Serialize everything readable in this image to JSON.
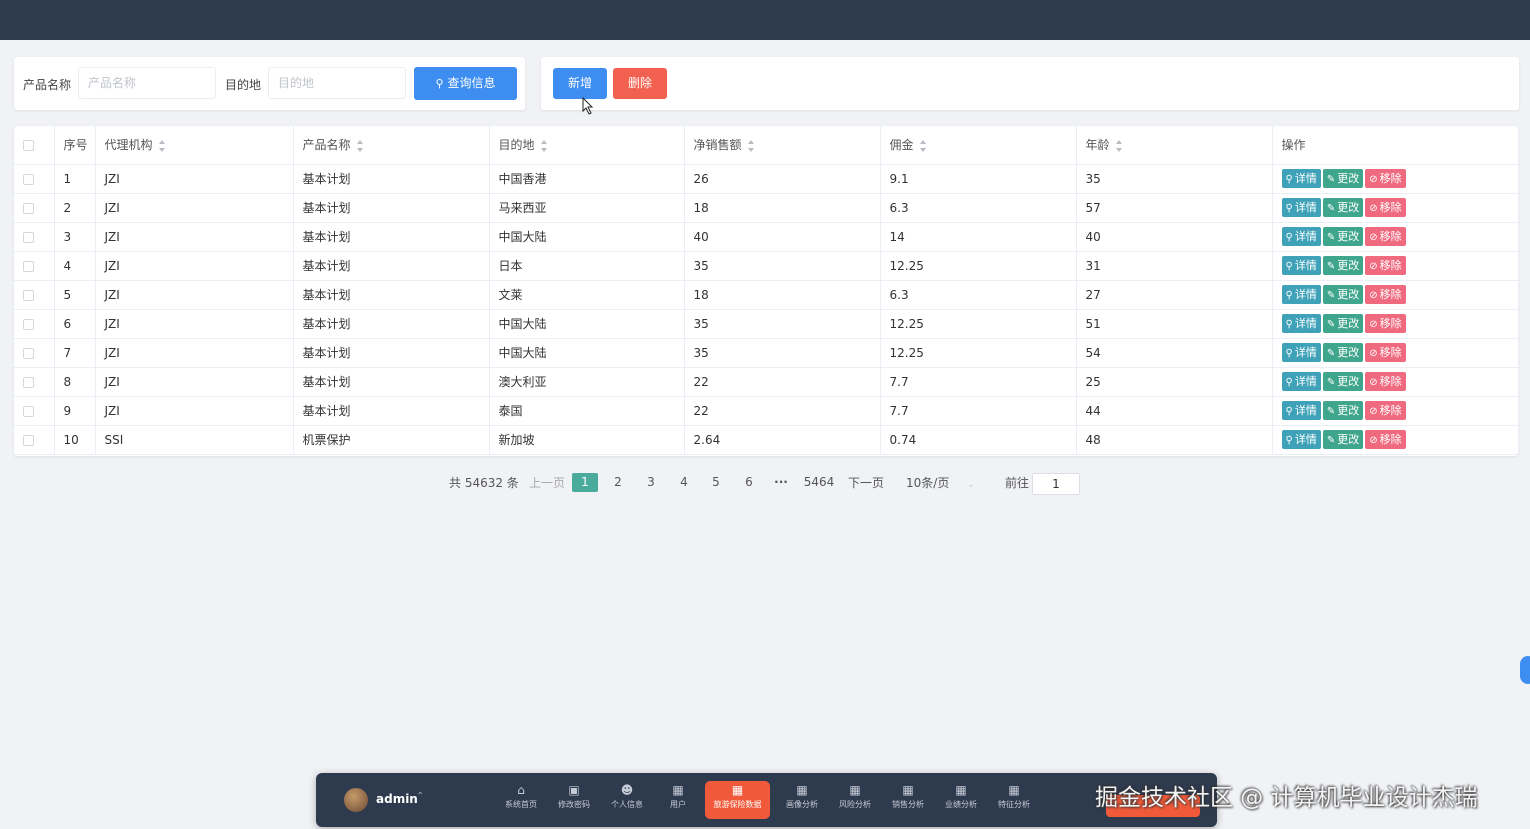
{
  "search": {
    "product_label": "产品名称",
    "product_placeholder": "产品名称",
    "dest_label": "目的地",
    "dest_placeholder": "目的地",
    "query_button": "查询信息"
  },
  "actions": {
    "add_button": "新增",
    "delete_button": "删除"
  },
  "table": {
    "headers": [
      "序号",
      "代理机构",
      "产品名称",
      "目的地",
      "净销售额",
      "佣金",
      "年龄",
      "操作"
    ],
    "op_labels": {
      "detail": "详情",
      "edit": "更改",
      "remove": "移除"
    },
    "rows": [
      [
        "1",
        "JZI",
        "基本计划",
        "中国香港",
        "26",
        "9.1",
        "35"
      ],
      [
        "2",
        "JZI",
        "基本计划",
        "马来西亚",
        "18",
        "6.3",
        "57"
      ],
      [
        "3",
        "JZI",
        "基本计划",
        "中国大陆",
        "40",
        "14",
        "40"
      ],
      [
        "4",
        "JZI",
        "基本计划",
        "日本",
        "35",
        "12.25",
        "31"
      ],
      [
        "5",
        "JZI",
        "基本计划",
        "文莱",
        "18",
        "6.3",
        "27"
      ],
      [
        "6",
        "JZI",
        "基本计划",
        "中国大陆",
        "35",
        "12.25",
        "51"
      ],
      [
        "7",
        "JZI",
        "基本计划",
        "中国大陆",
        "35",
        "12.25",
        "54"
      ],
      [
        "8",
        "JZI",
        "基本计划",
        "澳大利亚",
        "22",
        "7.7",
        "25"
      ],
      [
        "9",
        "JZI",
        "基本计划",
        "泰国",
        "22",
        "7.7",
        "44"
      ],
      [
        "10",
        "SSI",
        "机票保护",
        "新加坡",
        "2.64",
        "0.74",
        "48"
      ]
    ]
  },
  "pagination": {
    "total": "共 54632 条",
    "prev": "上一页",
    "pages": [
      "1",
      "2",
      "3",
      "4",
      "5",
      "6"
    ],
    "ellipsis": "···",
    "last": "5464",
    "next": "下一页",
    "page_size": "10条/页",
    "goto_label": "前往",
    "goto_value": "1"
  },
  "dock": {
    "username": "admin",
    "items": [
      {
        "label": "系统首页",
        "icon": "home-icon"
      },
      {
        "label": "修改密码",
        "icon": "lock-icon"
      },
      {
        "label": "个人信息",
        "icon": "user-icon"
      },
      {
        "label": "用户",
        "icon": "grid-icon"
      },
      {
        "label": "旅游保险数据",
        "icon": "grid-icon"
      },
      {
        "label": "画像分析",
        "icon": "grid-icon"
      },
      {
        "label": "风险分析",
        "icon": "grid-icon"
      },
      {
        "label": "销售分析",
        "icon": "grid-icon"
      },
      {
        "label": "业绩分析",
        "icon": "grid-icon"
      },
      {
        "label": "特征分析",
        "icon": "grid-icon"
      }
    ]
  },
  "watermark": "掘金技术社区 @ 计算机毕业设计杰瑞",
  "colors": {
    "topbar": "#2e3a4e",
    "primary": "#3d8ef0",
    "danger": "#f2604f",
    "active_page": "#4aaa9b",
    "dock_active": "#f05a3a"
  }
}
